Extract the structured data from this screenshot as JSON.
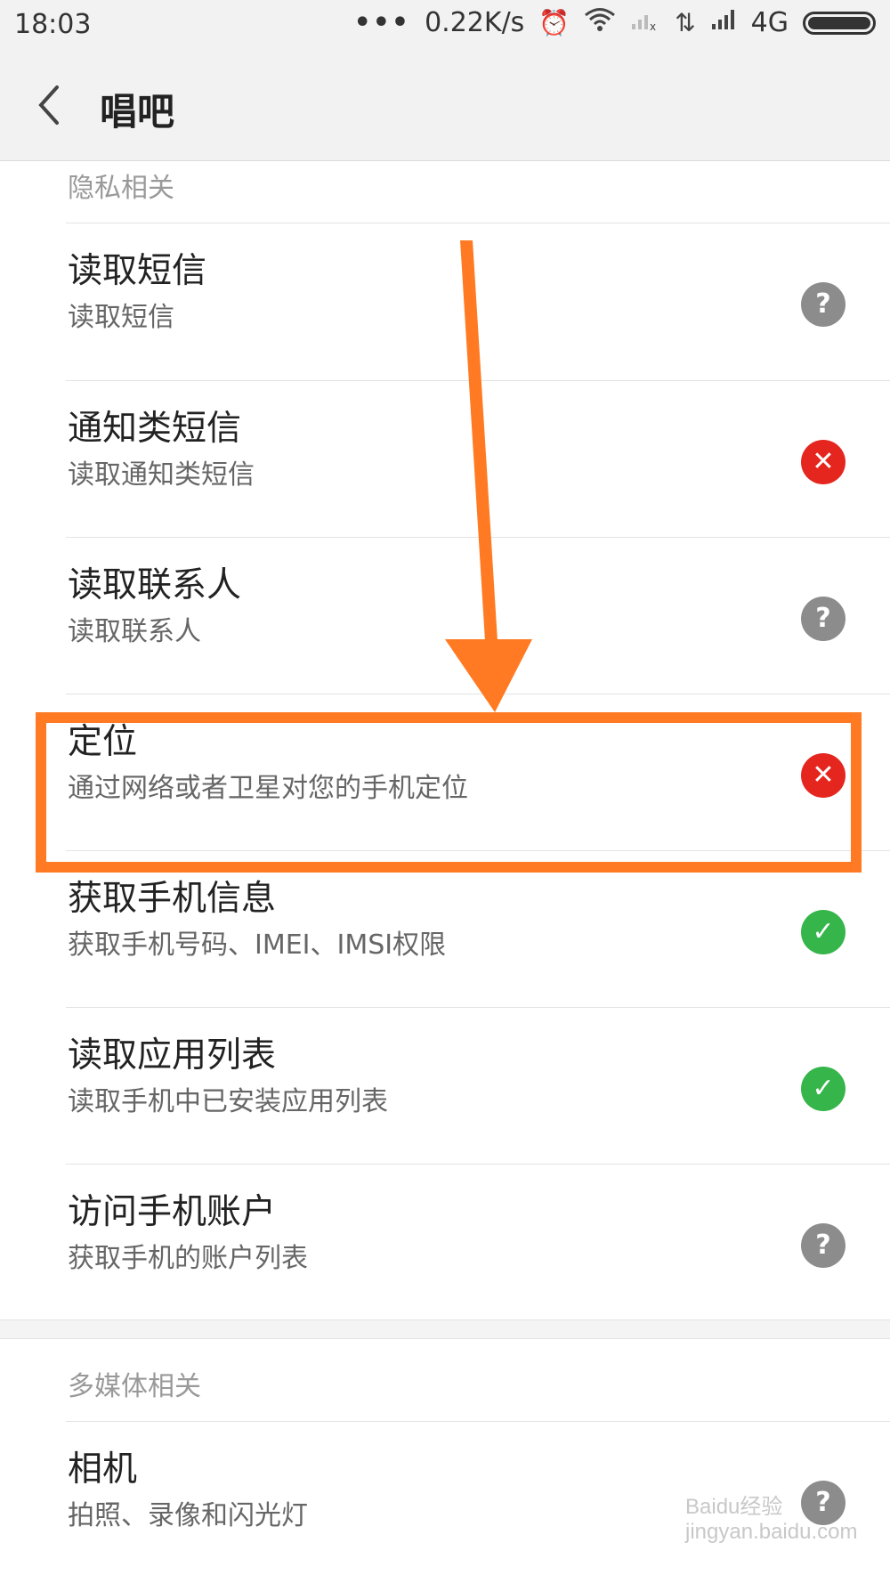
{
  "status_bar": {
    "time": "18:03",
    "dots": "•••",
    "speed": "0.22K/s",
    "network": "4G",
    "icons": [
      "alarm-icon",
      "wifi-icon",
      "signal-x-icon",
      "data-arrows-icon",
      "signal-icon",
      "battery-icon"
    ]
  },
  "titlebar": {
    "title": "唱吧"
  },
  "sections": {
    "privacy": "隐私相关",
    "media": "多媒体相关"
  },
  "items": [
    {
      "title": "读取短信",
      "subtitle": "读取短信",
      "status": "ask",
      "glyph": "?"
    },
    {
      "title": "通知类短信",
      "subtitle": "读取通知类短信",
      "status": "denied",
      "glyph": "✕"
    },
    {
      "title": "读取联系人",
      "subtitle": "读取联系人",
      "status": "ask",
      "glyph": "?"
    },
    {
      "title": "定位",
      "subtitle": "通过网络或者卫星对您的手机定位",
      "status": "denied",
      "glyph": "✕"
    },
    {
      "title": "获取手机信息",
      "subtitle": "获取手机号码、IMEI、IMSI权限",
      "status": "allowed",
      "glyph": "✓"
    },
    {
      "title": "读取应用列表",
      "subtitle": "读取手机中已安装应用列表",
      "status": "allowed",
      "glyph": "✓"
    },
    {
      "title": "访问手机账户",
      "subtitle": "获取手机的账户列表",
      "status": "ask",
      "glyph": "?"
    },
    {
      "title": "相机",
      "subtitle": "拍照、录像和闪光灯",
      "status": "ask",
      "glyph": "?"
    }
  ],
  "watermark": "Baidu经验 jingyan.baidu.com",
  "colors": {
    "highlight": "#ff7a22",
    "denied": "#e5261f",
    "allowed": "#35b54a",
    "ask": "#8c8c8c"
  }
}
